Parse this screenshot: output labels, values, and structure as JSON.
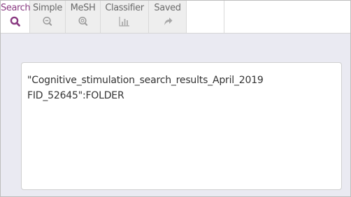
{
  "colors": {
    "active": "#8a3b82",
    "inactive_tab_bg": "#eeeeee",
    "panel_bg": "#eaeaf2"
  },
  "tabs": [
    {
      "label": "Search",
      "icon": "search-icon",
      "active": true
    },
    {
      "label": "Simple",
      "icon": "zoom-out-icon",
      "active": false
    },
    {
      "label": "MeSH",
      "icon": "zoom-info-icon",
      "active": false
    },
    {
      "label": "Classifier",
      "icon": "bar-chart-icon",
      "active": false
    },
    {
      "label": "Saved",
      "icon": "share-arrow-icon",
      "active": false
    }
  ],
  "editor": {
    "line1": "\"Cognitive_stimulation_search_results_April_2019",
    "line2": "FID_52645\":FOLDER"
  }
}
